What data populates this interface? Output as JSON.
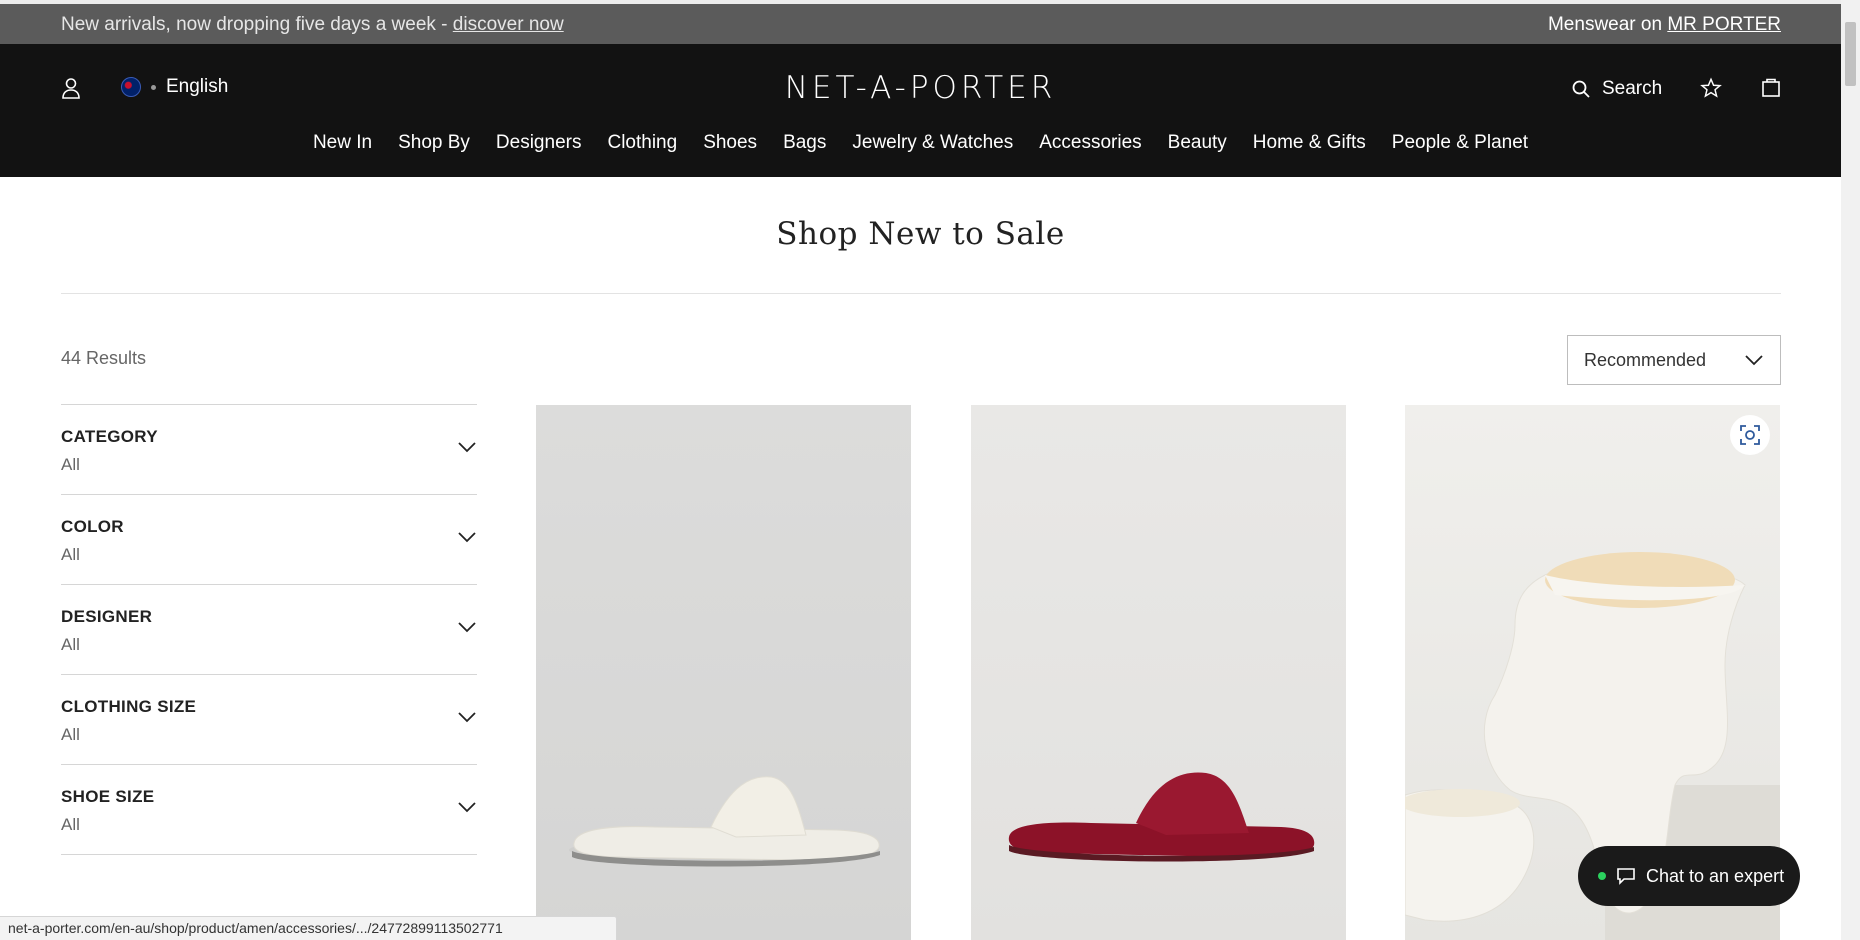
{
  "promo": {
    "text": "New arrivals, now dropping five days a week - ",
    "link": "discover now",
    "right_text": "Menswear on ",
    "right_link": "MR PORTER"
  },
  "header": {
    "language": "English",
    "logo": "NET-A-PORTER",
    "search_label": "Search"
  },
  "nav": [
    "New In",
    "Shop By",
    "Designers",
    "Clothing",
    "Shoes",
    "Bags",
    "Jewelry & Watches",
    "Accessories",
    "Beauty",
    "Home & Gifts",
    "People & Planet"
  ],
  "main": {
    "title": "Shop New to Sale",
    "results": "44 Results",
    "sort_value": "Recommended"
  },
  "filters": [
    {
      "title": "CATEGORY",
      "value": "All"
    },
    {
      "title": "COLOR",
      "value": "All"
    },
    {
      "title": "DESIGNER",
      "value": "All"
    },
    {
      "title": "CLOTHING SIZE",
      "value": "All"
    },
    {
      "title": "SHOE SIZE",
      "value": "All"
    }
  ],
  "chat": {
    "label": "Chat to an expert"
  },
  "status_url": "net-a-porter.com/en-au/shop/product/amen/accessories/.../24772899113502771",
  "colors": {
    "promo_bg": "#5b5b5b",
    "header_bg": "#121212",
    "chat_online": "#2bd15e"
  }
}
